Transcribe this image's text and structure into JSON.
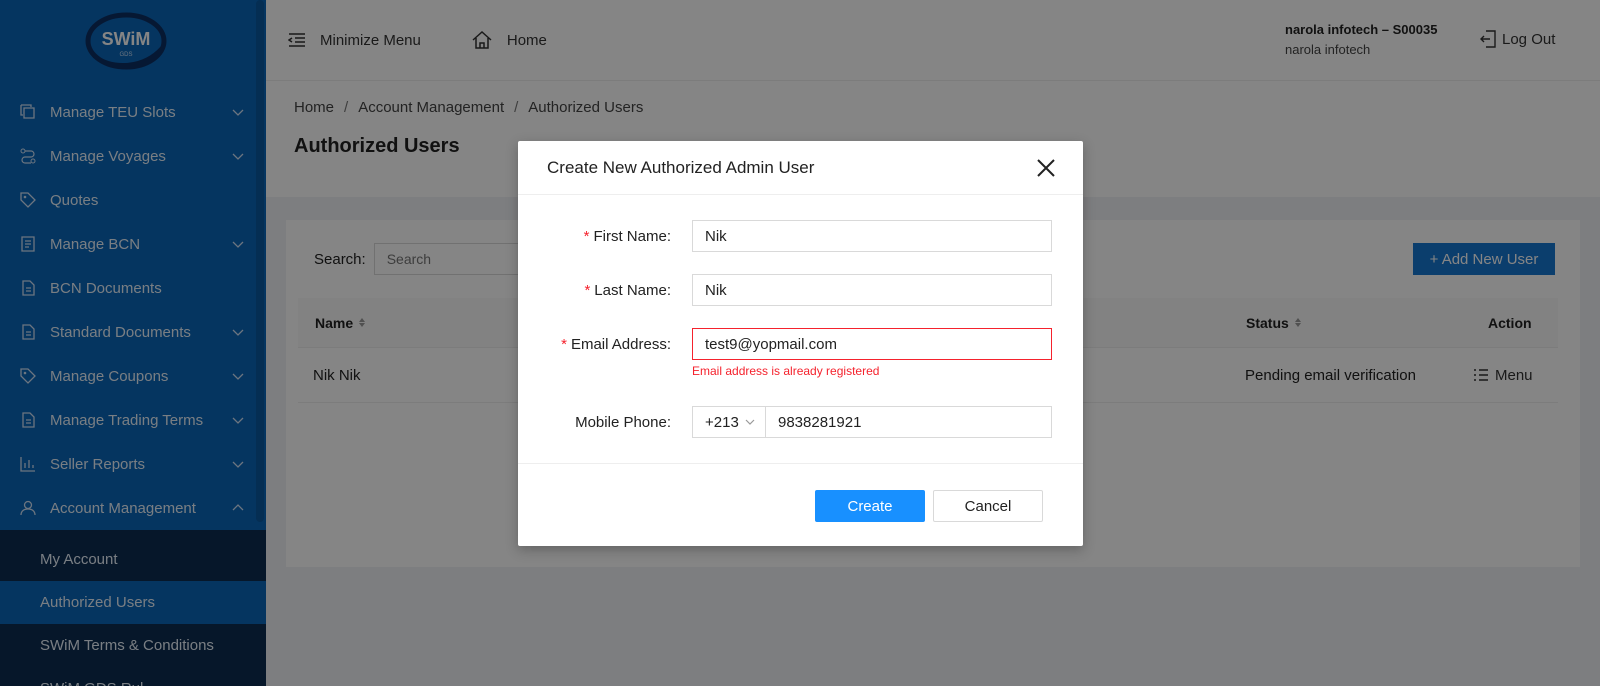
{
  "sidebar": {
    "logo_text": "SWiM",
    "logo_sub": "GDS",
    "items": [
      {
        "label": "Manage TEU Slots",
        "icon": "copy-icon",
        "has_children": true
      },
      {
        "label": "Manage Voyages",
        "icon": "route-icon",
        "has_children": true
      },
      {
        "label": "Quotes",
        "icon": "tag-icon",
        "has_children": false
      },
      {
        "label": "Manage BCN",
        "icon": "document-icon",
        "has_children": true
      },
      {
        "label": "BCN Documents",
        "icon": "file-icon",
        "has_children": false
      },
      {
        "label": "Standard Documents",
        "icon": "file-icon",
        "has_children": true
      },
      {
        "label": "Manage Coupons",
        "icon": "tag-icon",
        "has_children": true
      },
      {
        "label": "Manage Trading Terms",
        "icon": "file-icon",
        "has_children": true
      },
      {
        "label": "Seller Reports",
        "icon": "bar-chart-icon",
        "has_children": true
      },
      {
        "label": "Account Management",
        "icon": "user-icon",
        "has_children": true,
        "expanded": true
      }
    ],
    "sub_items": [
      {
        "label": "My Account",
        "active": false
      },
      {
        "label": "Authorized Users",
        "active": true
      },
      {
        "label": "SWiM Terms & Conditions",
        "active": false
      },
      {
        "label": "SWiM GDS Rul",
        "active": false
      }
    ]
  },
  "header": {
    "minimize_label": "Minimize Menu",
    "home_label": "Home",
    "user_line1": "narola infotech – S00035",
    "user_line2": "narola infotech",
    "logout_label": "Log Out"
  },
  "page": {
    "breadcrumb": [
      "Home",
      "Account Management",
      "Authorized Users"
    ],
    "title": "Authorized Users"
  },
  "card": {
    "search_label": "Search:",
    "search_placeholder": "Search",
    "add_button": "+ Add New User",
    "columns": {
      "name": "Name",
      "status": "Status",
      "action": "Action"
    },
    "rows": [
      {
        "name": "Nik Nik",
        "status": "Pending email verification",
        "action": "Menu"
      }
    ]
  },
  "modal": {
    "title": "Create New Authorized Admin User",
    "required_mark": "*",
    "first_name_label": "First Name:",
    "first_name_value": "Nik",
    "last_name_label": "Last Name:",
    "last_name_value": "Nik",
    "email_label": "Email Address:",
    "email_value": "test9@yopmail.com",
    "email_error": "Email address is already registered",
    "phone_label": "Mobile Phone:",
    "phone_prefix": "+213",
    "phone_value": "9838281921",
    "create_label": "Create",
    "cancel_label": "Cancel"
  },
  "colors": {
    "sidebar_bg": "#0a66b8",
    "submenu_bg": "#0c2d52",
    "primary": "#1890ff",
    "error": "#f5222d"
  }
}
